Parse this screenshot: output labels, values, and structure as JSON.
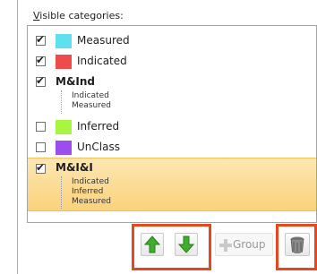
{
  "section": {
    "label_underlined": "V",
    "label_rest": "isible categories:"
  },
  "categories": [
    {
      "label": "Measured",
      "checked": true,
      "color": "#5ee0ee"
    },
    {
      "label": "Indicated",
      "checked": true,
      "color": "#ee4c4c"
    },
    {
      "label": "M&Ind",
      "checked": true,
      "color": "",
      "sub": [
        "Indicated",
        "Measured"
      ]
    },
    {
      "label": "Inferred",
      "checked": false,
      "color": "#a8f542"
    },
    {
      "label": "UnClass",
      "checked": false,
      "color": "#9c4ded"
    },
    {
      "label": "M&I&I",
      "checked": true,
      "color": "",
      "sub": [
        "Indicated",
        "Inferred",
        "Measured"
      ],
      "selected": true
    }
  ],
  "toolbar": {
    "move_up_icon": "up-arrow-icon",
    "move_down_icon": "down-arrow-icon",
    "group_label": "Group",
    "delete_icon": "trash-icon"
  }
}
